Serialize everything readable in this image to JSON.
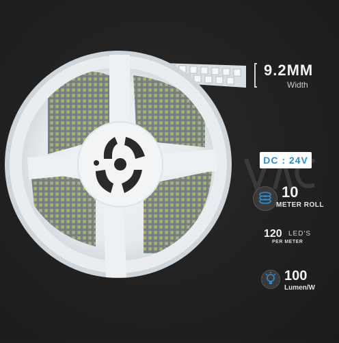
{
  "product": "LED strip reel",
  "specs": {
    "width_value": "9.2MM",
    "width_label": "Width",
    "voltage": "DC : 24V",
    "roll_length_value": "10",
    "roll_length_label": "METER ROLL",
    "led_count_value": "120",
    "led_count_unit": "LED'S",
    "led_count_label": "PER METER",
    "lumen_value": "100",
    "lumen_label": "Lumen/W"
  },
  "colors": {
    "background": "#222222",
    "reel": "#e9edf0",
    "accent_blue": "#2e8dd1",
    "strip_white": "#f4f6f8"
  },
  "icons": {
    "roll": "roll-coil-icon",
    "lumen": "lightbulb-icon",
    "watermark": "brand-watermark-icon"
  }
}
